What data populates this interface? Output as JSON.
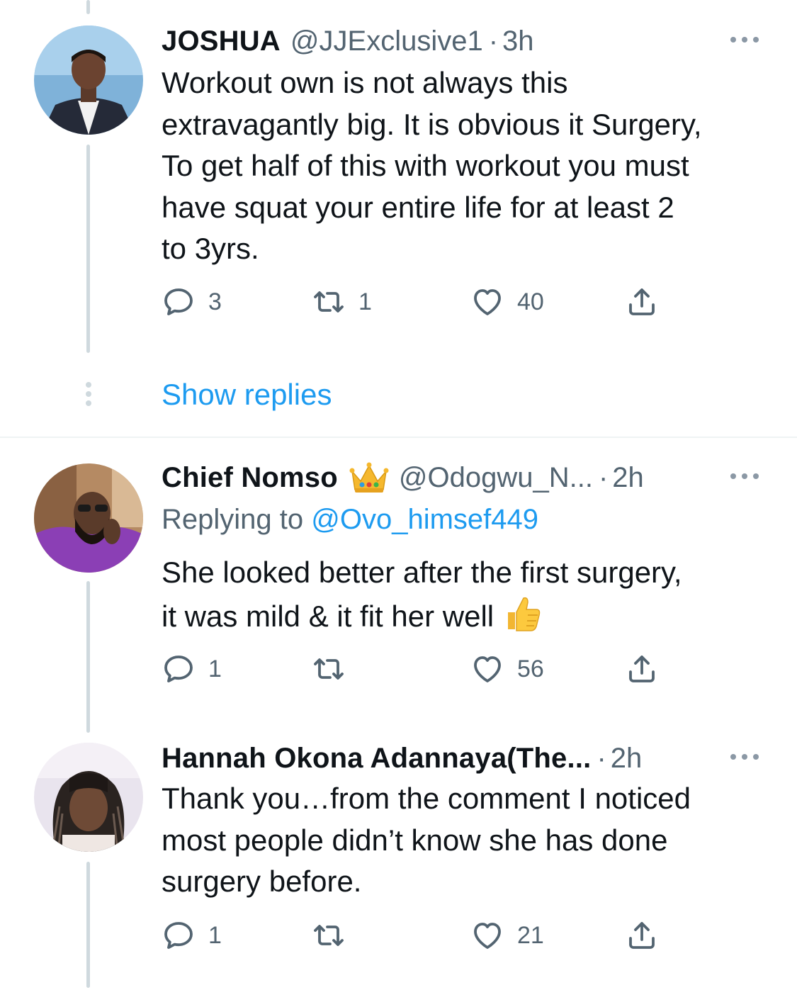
{
  "tweets": [
    {
      "name": "JOSHUA",
      "handle": "@JJExclusive1",
      "separator": "·",
      "time": "3h",
      "text_lines": [
        "Workout own is not always this",
        "extravagantly big. It is obvious it Surgery,",
        "To get half of this with workout you must",
        "have squat your entire life for at least 2",
        "to 3yrs."
      ],
      "replies": "3",
      "retweets": "1",
      "likes": "40"
    },
    {
      "name": "Chief Nomso",
      "name_emoji": "crown-icon",
      "handle": "@Odogwu_N...",
      "separator": "·",
      "time": "2h",
      "replying_prefix": "Replying to",
      "replying_to": "@Ovo_himsef449",
      "text_lines": [
        "She looked better after the first surgery,",
        "it was mild & it fit her well"
      ],
      "text_emoji": "thumbs-up-icon",
      "replies": "1",
      "retweets": "",
      "likes": "56"
    },
    {
      "name": "Hannah Okona Adannaya(The...",
      "handle": "",
      "separator": "·",
      "time": "2h",
      "text_lines": [
        "Thank you…from the comment I noticed",
        "most people didn’t know she has done",
        "surgery before."
      ],
      "replies": "1",
      "retweets": "",
      "likes": "21"
    }
  ],
  "show_replies": "Show replies",
  "colors": {
    "link": "#1d9bf0",
    "secondary_text": "#536471",
    "primary_text": "#0f1419",
    "thread_line": "#cfd9de",
    "divider": "#eff3f4"
  }
}
